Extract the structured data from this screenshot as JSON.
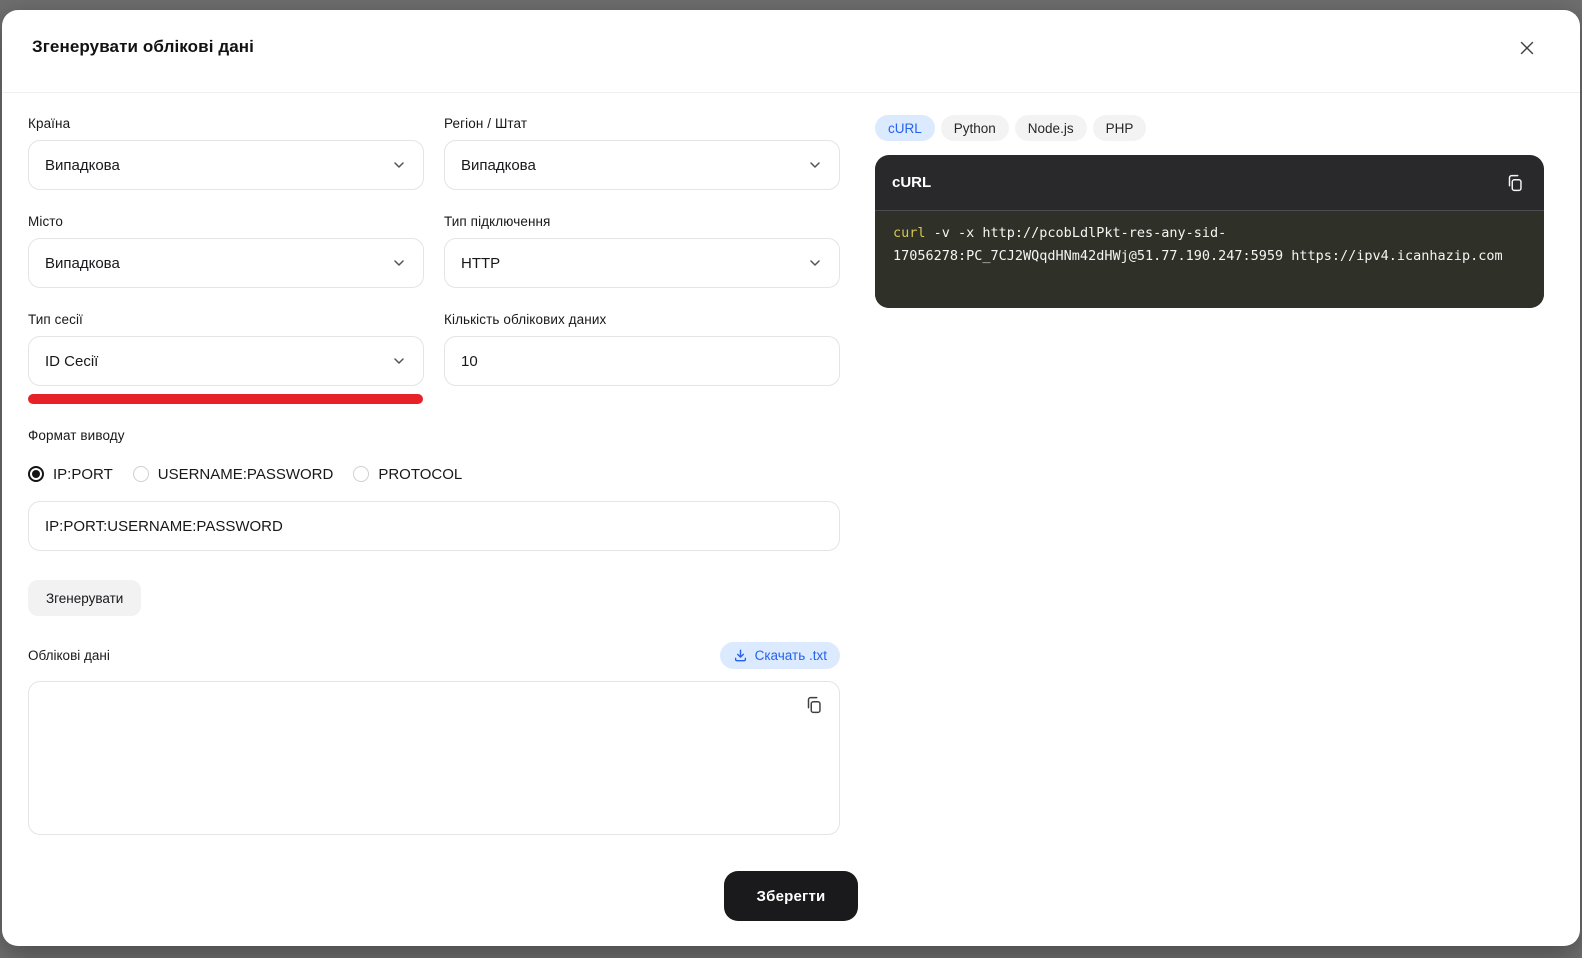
{
  "modal": {
    "title": "Згенерувати облікові дані"
  },
  "form": {
    "country": {
      "label": "Країна",
      "value": "Випадкова"
    },
    "region": {
      "label": "Регіон / Штат",
      "value": "Випадкова"
    },
    "city": {
      "label": "Місто",
      "value": "Випадкова"
    },
    "connection_type": {
      "label": "Тип підключення",
      "value": "HTTP"
    },
    "session_type": {
      "label": "Тип сесії",
      "value": "ID Сесії"
    },
    "credentials_count": {
      "label": "Кількість облікових даних",
      "value": "10"
    },
    "output_format": {
      "label": "Формат виводу",
      "options": [
        {
          "label": "IP:PORT",
          "selected": true
        },
        {
          "label": "USERNAME:PASSWORD",
          "selected": false
        },
        {
          "label": "PROTOCOL",
          "selected": false
        }
      ],
      "custom_value": "IP:PORT:USERNAME:PASSWORD"
    },
    "generate_button": "Згенерувати",
    "credentials": {
      "label": "Облікові дані",
      "download_button": "Скачать .txt",
      "value": ""
    },
    "save_button": "Зберегти"
  },
  "code_panel": {
    "tabs": [
      {
        "label": "cURL",
        "active": true
      },
      {
        "label": "Python",
        "active": false
      },
      {
        "label": "Node.js",
        "active": false
      },
      {
        "label": "PHP",
        "active": false
      }
    ],
    "block_title": "cURL",
    "code": {
      "keyword": "curl",
      "rest": " -v -x http://pcobLdlPkt-res-any-sid-17056278:PC_7CJ2WQqdHNm42dHWj@51.77.190.247:5959 https://ipv4.icanhazip.com"
    }
  },
  "colors": {
    "accent_blue": "#2563eb",
    "accent_blue_bg": "#dbeafe",
    "error_red": "#e62228",
    "dark_button": "#1a1a1c",
    "code_block_bg": "#29292c",
    "code_keyword": "#d8c54e"
  }
}
